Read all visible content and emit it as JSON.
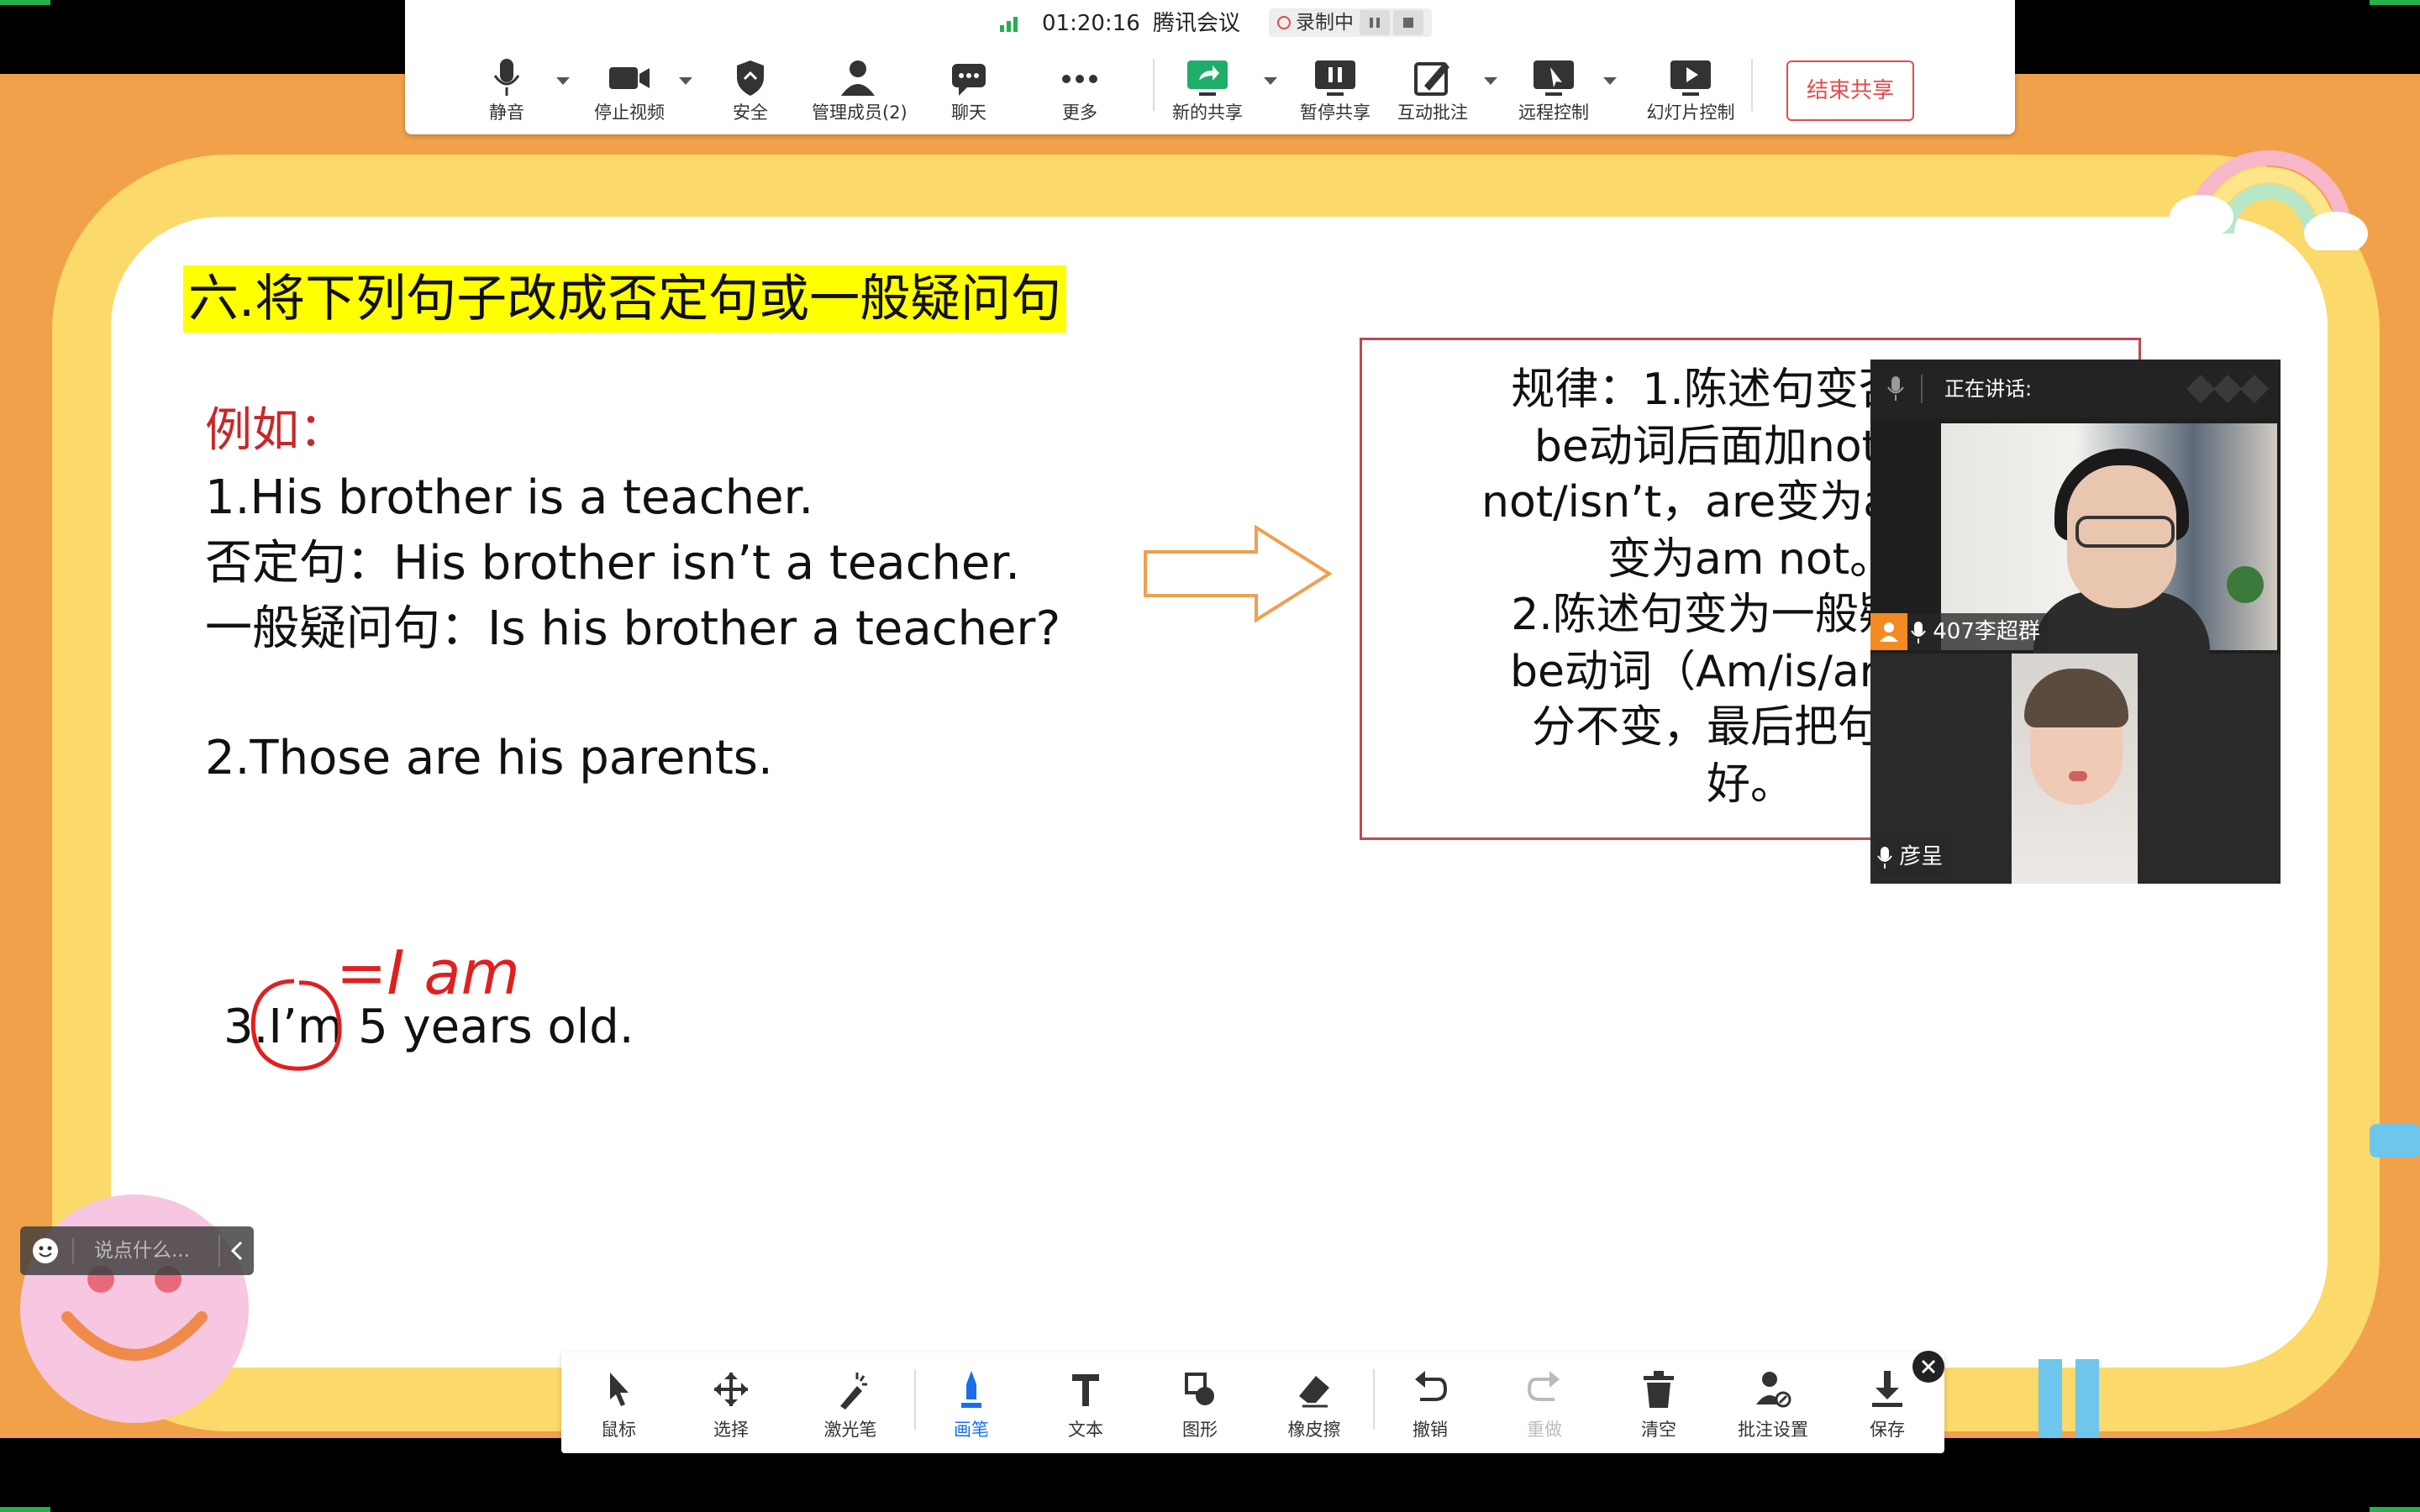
{
  "meeting": {
    "timer": "01:20:16",
    "app_name": "腾讯会议",
    "recording_label": "录制中"
  },
  "toolbar": {
    "mute": "静音",
    "stop_video": "停止视频",
    "security": "安全",
    "members": "管理成员(2)",
    "chat": "聊天",
    "more": "更多",
    "new_share": "新的共享",
    "pause_share": "暂停共享",
    "annotate": "互动批注",
    "remote_control": "远程控制",
    "slideshow_control": "幻灯片控制",
    "end_share": "结束共享"
  },
  "slide": {
    "title": "六.将下列句子改成否定句或一般疑问句",
    "example_label": "例如：",
    "ex1": "1.His brother is a teacher.",
    "ex1_neg": "否定句：His brother isn’t  a teacher.",
    "ex1_q": "一般疑问句：Is his brother a teacher?",
    "ex2": "2.Those are his parents.",
    "ex3": "3.I’m 5 years old.",
    "annotation": "=I am",
    "rule_lines": [
      "规律：1.陈述句变否定句",
      "be动词后面加not，即",
      "not/isn’t，are变为are not",
      "变为am not。",
      "2.陈述句变为一般疑问句",
      "be动词（Am/is/are）提",
      "分不变，最后把句末的",
      "好。"
    ]
  },
  "video": {
    "speaking_label": "正在讲话:",
    "participant1": "407李超群",
    "participant2": "彦呈"
  },
  "chat": {
    "placeholder": "说点什么..."
  },
  "annotation_toolbar": {
    "mouse": "鼠标",
    "select": "选择",
    "laser": "激光笔",
    "pen": "画笔",
    "text": "文本",
    "shape": "图形",
    "eraser": "橡皮擦",
    "undo": "撤销",
    "redo": "重做",
    "clear": "清空",
    "settings": "批注设置",
    "save": "保存"
  },
  "colors": {
    "accent_green": "#22b14c",
    "end_share_red": "#e04b4b",
    "pen_blue": "#1a6fe8",
    "annotation_red": "#e02020"
  }
}
